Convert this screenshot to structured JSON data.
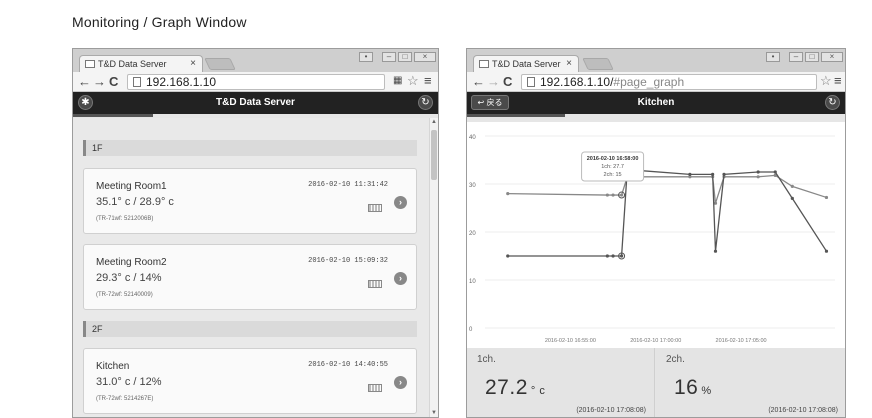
{
  "heading": "Monitoring / Graph Window",
  "left": {
    "tab": "T&D Data Server",
    "url": "192.168.1.10",
    "appbar_title": "T&D Data Server",
    "progress_fraction": 0.22,
    "floors": [
      {
        "label": "1F"
      },
      {
        "label": "2F"
      }
    ],
    "rooms": [
      {
        "name": "Meeting Room1",
        "date": "2016-02-10 11:31:42",
        "reading": "35.1° c / 28.9° c",
        "serial": "(TR-71wf: 5212006B)"
      },
      {
        "name": "Meeting Room2",
        "date": "2016-02-10 15:09:32",
        "reading": "29.3° c / 14%",
        "serial": "(TR-72wf: 52140009)"
      },
      {
        "name": "Kitchen",
        "date": "2016-02-10 14:40:55",
        "reading": "31.0° c / 12%",
        "serial": "(TR-72wf: 5214267E)"
      }
    ]
  },
  "right": {
    "tab": "T&D Data Server",
    "url_host": "192.168.1.10/",
    "url_path": "#page_graph",
    "back_label": "戻る",
    "appbar_title": "Kitchen",
    "progress_fraction": 0.26,
    "tooltip": {
      "time": "2016-02-10 16:58:00",
      "line1": "1ch: 27.7",
      "line2": "2ch: 15"
    },
    "panels": [
      {
        "label": "1ch.",
        "value": "27.2",
        "unit": "° c",
        "time": "(2016-02-10 17:08:08)"
      },
      {
        "label": "2ch.",
        "value": "16",
        "unit": "%",
        "time": "(2016-02-10 17:08:08)"
      }
    ]
  },
  "chart_data": {
    "type": "line",
    "ylim": [
      0,
      40
    ],
    "yticks": [
      0,
      10,
      20,
      30,
      40
    ],
    "xticks": [
      "2016-02-10 16:55:00",
      "2016-02-10 17:00:00",
      "2016-02-10 17:05:00"
    ],
    "tooltip_point": 3,
    "series": [
      {
        "name": "1ch",
        "color": "#888888",
        "points": [
          {
            "x": "16:51:20",
            "y": 28
          },
          {
            "x": "16:57:10",
            "y": 27.7
          },
          {
            "x": "16:57:30",
            "y": 27.7
          },
          {
            "x": "16:58:00",
            "y": 27.7
          },
          {
            "x": "16:58:20",
            "y": 31.5
          },
          {
            "x": "17:02:00",
            "y": 31.5
          },
          {
            "x": "17:03:20",
            "y": 31.5
          },
          {
            "x": "17:03:30",
            "y": 26
          },
          {
            "x": "17:04:00",
            "y": 31.5
          },
          {
            "x": "17:06:00",
            "y": 31.5
          },
          {
            "x": "17:07:00",
            "y": 31.8
          },
          {
            "x": "17:08:00",
            "y": 29.5
          },
          {
            "x": "17:10:00",
            "y": 27.2
          }
        ]
      },
      {
        "name": "2ch",
        "color": "#555555",
        "points": [
          {
            "x": "16:51:20",
            "y": 15
          },
          {
            "x": "16:57:10",
            "y": 15
          },
          {
            "x": "16:57:30",
            "y": 15
          },
          {
            "x": "16:58:00",
            "y": 15
          },
          {
            "x": "16:58:20",
            "y": 33
          },
          {
            "x": "17:02:00",
            "y": 32
          },
          {
            "x": "17:03:20",
            "y": 32
          },
          {
            "x": "17:03:30",
            "y": 16
          },
          {
            "x": "17:04:00",
            "y": 32
          },
          {
            "x": "17:06:00",
            "y": 32.5
          },
          {
            "x": "17:07:00",
            "y": 32.5
          },
          {
            "x": "17:08:00",
            "y": 27
          },
          {
            "x": "17:10:00",
            "y": 16
          }
        ]
      }
    ]
  }
}
